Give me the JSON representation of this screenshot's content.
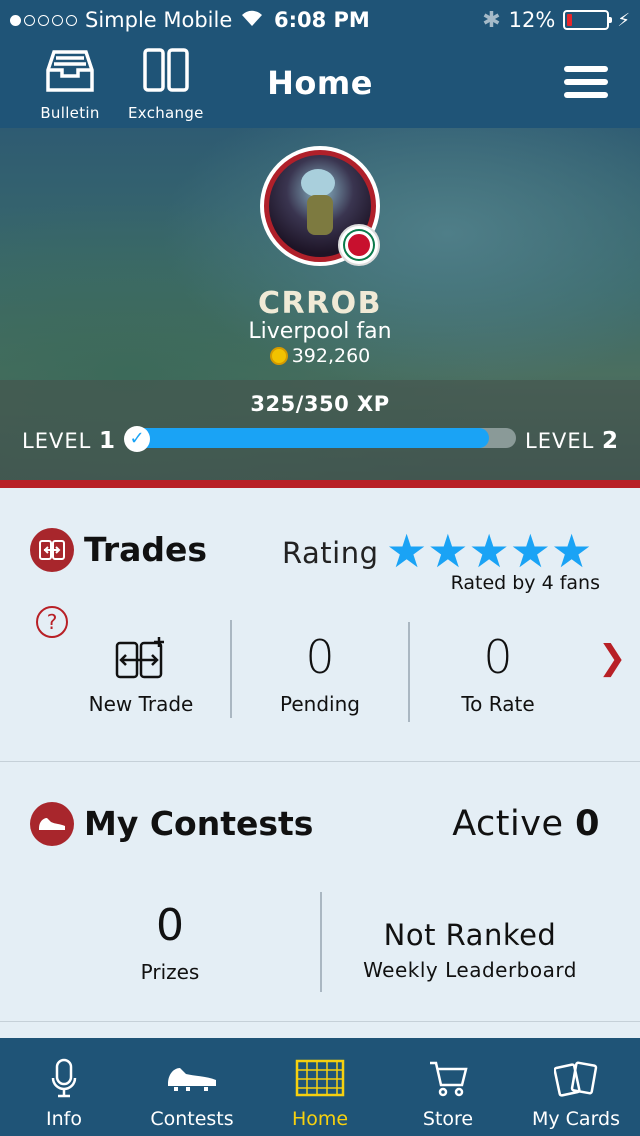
{
  "status_bar": {
    "carrier": "Simple Mobile",
    "time": "6:08 PM",
    "battery_percent": "12%",
    "battery_level": 0.12,
    "signal_bars": 1
  },
  "header": {
    "title": "Home",
    "bulletin_label": "Bulletin",
    "exchange_label": "Exchange"
  },
  "profile": {
    "username": "CRROB",
    "fan_of": "Liverpool fan",
    "coins": "392,260",
    "xp_text": "325/350 XP",
    "xp_progress": 0.93,
    "level_label": "LEVEL",
    "current_level": "1",
    "next_level": "2"
  },
  "trades": {
    "title": "Trades",
    "rating_label": "Rating",
    "rating_stars": 5,
    "rated_by": "Rated by 4 fans",
    "help_symbol": "?",
    "new_trade_label": "New Trade",
    "pending_count": "0",
    "pending_label": "Pending",
    "to_rate_count": "0",
    "to_rate_label": "To Rate"
  },
  "contests": {
    "title": "My Contests",
    "active_label": "Active",
    "active_count": "0",
    "prizes_count": "0",
    "prizes_label": "Prizes",
    "rank_title": "Not Ranked",
    "rank_caption": "Weekly Leaderboard"
  },
  "tab_bar": {
    "tabs": [
      {
        "label": "Info",
        "icon": "microphone-icon"
      },
      {
        "label": "Contests",
        "icon": "cleat-icon"
      },
      {
        "label": "Home",
        "icon": "goal-icon"
      },
      {
        "label": "Store",
        "icon": "cart-icon"
      },
      {
        "label": "My Cards",
        "icon": "cards-icon"
      }
    ],
    "active_tab": "Home"
  },
  "colors": {
    "primary": "#1f5477",
    "accent_red": "#b82026",
    "xp_blue": "#1aa3f5",
    "active_tab": "#f7d10f"
  }
}
